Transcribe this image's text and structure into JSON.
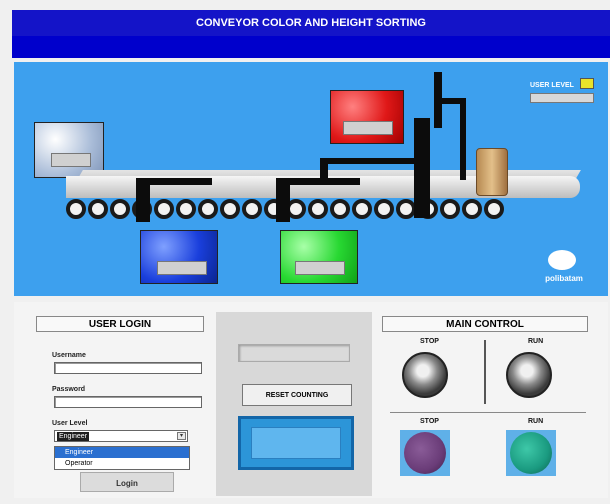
{
  "window": {
    "title": "CONVEYOR COLOR AND HEIGHT SORTING"
  },
  "indicator": {
    "user_level_label": "USER LEVEL",
    "led_color": "#e9e22a"
  },
  "branding": {
    "logo_text": "polibatam"
  },
  "colors": {
    "scene_bg": "#3da0ee",
    "silver_bin": "#b8c8de",
    "red_bin": "#e01818",
    "blue_bin": "#1a3fdc",
    "green_bin": "#28d832"
  },
  "login": {
    "title": "USER LOGIN",
    "username_label": "Username",
    "username_value": "",
    "password_label": "Password",
    "password_value": "",
    "user_level_label": "User Level",
    "user_level_selected": "Engineer",
    "user_level_options": [
      "Engineer",
      "Operator"
    ],
    "login_button": "Login"
  },
  "counter": {
    "reset_button": "RESET COUNTING"
  },
  "main_control": {
    "title": "MAIN CONTROL",
    "stop_label": "STOP",
    "run_label": "RUN",
    "stop_lamp_label": "STOP",
    "run_lamp_label": "RUN",
    "stop_lamp_color": "#6a3c78",
    "run_lamp_color": "#1a9a80"
  }
}
